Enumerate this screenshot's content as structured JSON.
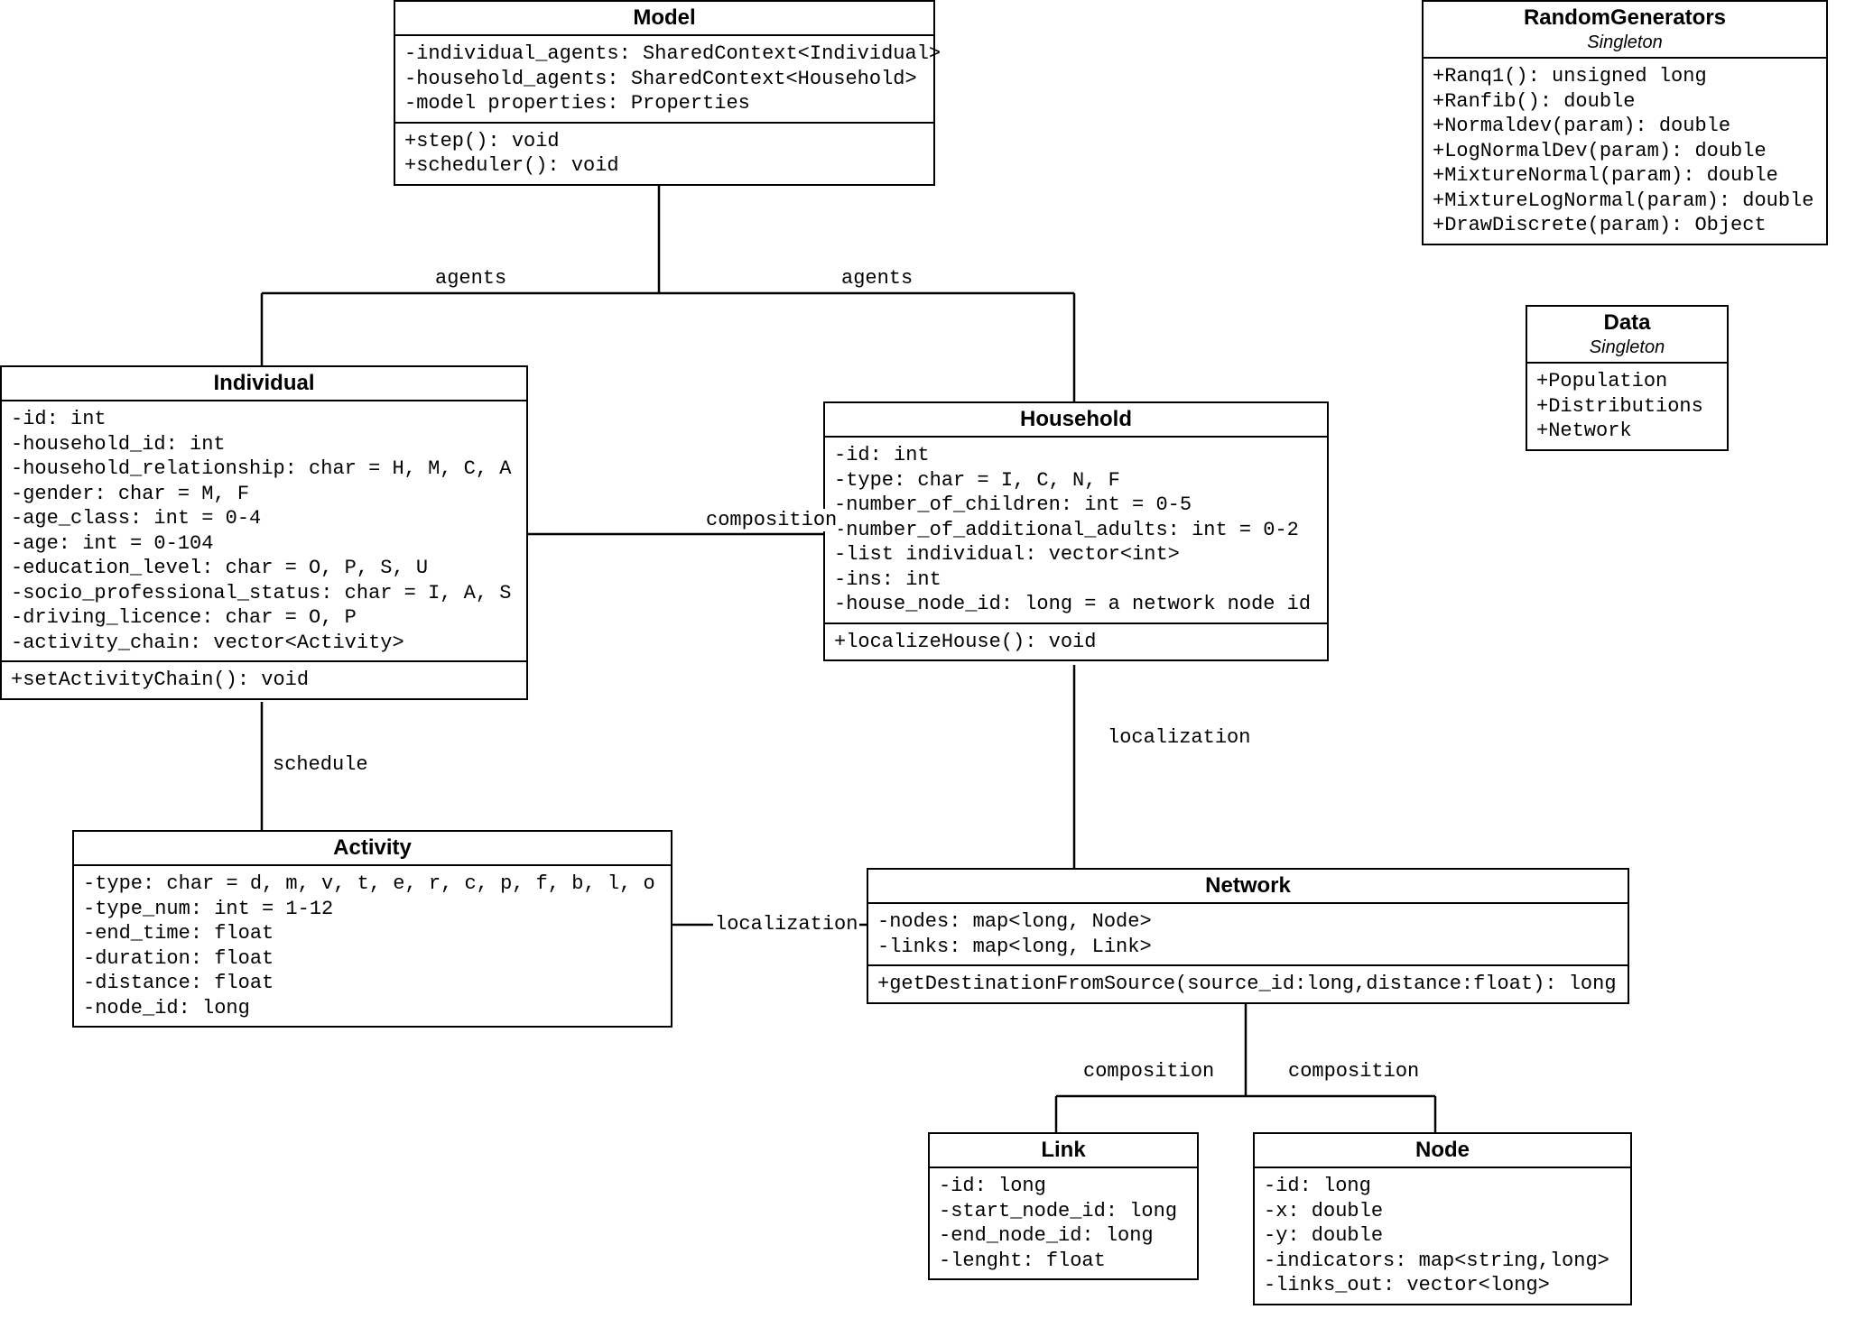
{
  "classes": {
    "model": {
      "name": "Model",
      "attrs": [
        "-individual_agents: SharedContext<Individual>",
        "-household_agents: SharedContext<Household>",
        "-model properties: Properties"
      ],
      "ops": [
        "+step(): void",
        "+scheduler(): void"
      ]
    },
    "randomgen": {
      "name": "RandomGenerators",
      "stereo": "Singleton",
      "ops": [
        "+Ranq1(): unsigned long",
        "+Ranfib(): double",
        "+Normaldev(param): double",
        "+LogNormalDev(param): double",
        "+MixtureNormal(param): double",
        "+MixtureLogNormal(param): double",
        "+DrawDiscrete(param): Object"
      ]
    },
    "data": {
      "name": "Data",
      "stereo": "Singleton",
      "attrs": [
        "+Population",
        "+Distributions",
        "+Network"
      ]
    },
    "individual": {
      "name": "Individual",
      "attrs": [
        "-id: int",
        "-household_id: int",
        "-household_relationship: char = H, M, C, A",
        "-gender: char = M, F",
        "-age_class: int = 0-4",
        "-age: int = 0-104",
        "-education_level: char = O, P, S, U",
        "-socio_professional_status: char = I, A, S",
        "-driving_licence: char = O, P",
        "-activity_chain: vector<Activity>"
      ],
      "ops": [
        "+setActivityChain(): void"
      ]
    },
    "household": {
      "name": "Household",
      "attrs": [
        "-id: int",
        "-type: char = I, C, N, F",
        "-number_of_children: int = 0-5",
        "-number_of_additional_adults: int = 0-2",
        "-list individual: vector<int>",
        "-ins: int",
        "-house_node_id: long = a network node id"
      ],
      "ops": [
        "+localizeHouse(): void"
      ]
    },
    "activity": {
      "name": "Activity",
      "attrs": [
        "-type: char = d, m, v, t, e, r, c, p, f, b, l, o",
        "-type_num: int = 1-12",
        "-end_time: float",
        "-duration: float",
        "-distance: float",
        "-node_id: long"
      ]
    },
    "network": {
      "name": "Network",
      "attrs": [
        "-nodes: map<long, Node>",
        "-links: map<long, Link>"
      ],
      "ops": [
        "+getDestinationFromSource(source_id:long,distance:float): long"
      ]
    },
    "link": {
      "name": "Link",
      "attrs": [
        "-id: long",
        "-start_node_id: long",
        "-end_node_id: long",
        "-lenght: float"
      ]
    },
    "node": {
      "name": "Node",
      "attrs": [
        "-id: long",
        "-x: double",
        "-y: double",
        "-indicators: map<string,long>",
        "-links_out: vector<long>"
      ]
    }
  },
  "labels": {
    "agents1": "agents",
    "agents2": "agents",
    "composition": "composition",
    "schedule": "schedule",
    "localization1": "localization",
    "localization2": "localization",
    "composition2": "composition",
    "composition3": "composition"
  }
}
